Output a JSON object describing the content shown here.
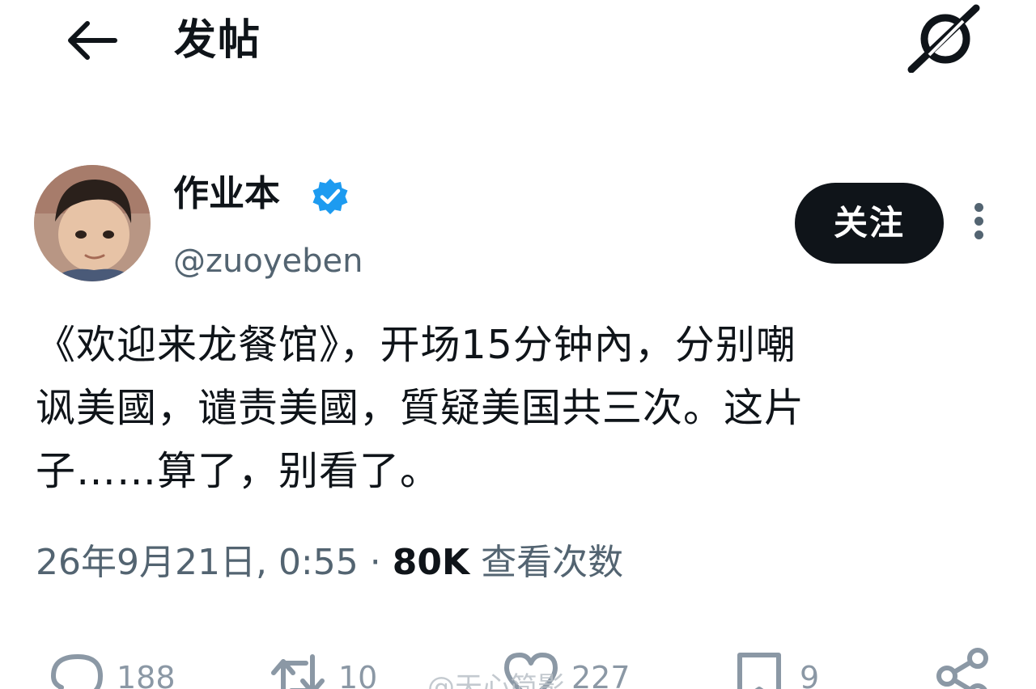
{
  "header": {
    "title": "发帖"
  },
  "author": {
    "display_name": "作业本",
    "handle": "@zuoyeben",
    "follow_label": "关注"
  },
  "tweet": {
    "lines": [
      "《欢迎来龙餐馆》，开场15分钟內，分别嘲",
      "讽美國，谴责美國，質疑美国共三次。这片",
      "子……算了，别看了。"
    ]
  },
  "meta": {
    "date": "26年9月21日, 0:55",
    "separator": "·",
    "views": "80K",
    "views_label": "查看次数"
  },
  "actions": {
    "replies": "188",
    "retweets": "10",
    "likes": "227",
    "bookmarks": "9"
  },
  "watermark": {
    "text": "@天心简影"
  },
  "colors": {
    "accent": "#1d9bf0",
    "text": "#0f1419",
    "secondary": "#536471",
    "follow_bg": "#0f1419"
  },
  "icons": [
    "back-arrow-icon",
    "grok-icon",
    "verified-badge-icon",
    "more-icon",
    "reply-icon",
    "retweet-icon",
    "like-icon",
    "bookmark-icon",
    "share-icon"
  ]
}
